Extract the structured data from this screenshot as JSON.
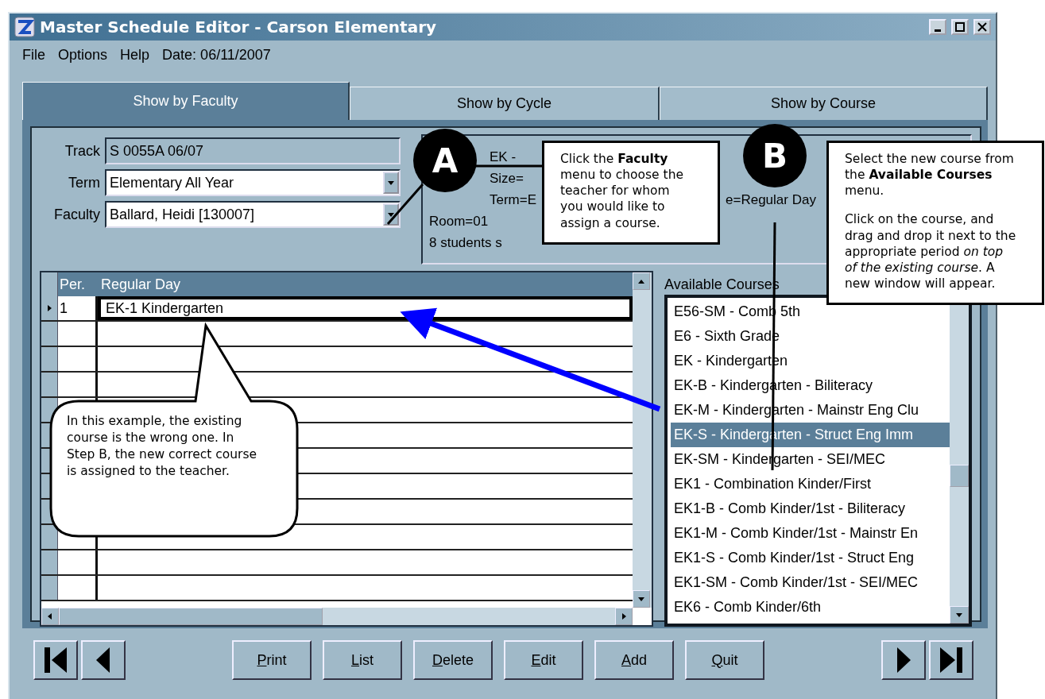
{
  "window": {
    "title": "Master Schedule Editor - Carson Elementary"
  },
  "menu": [
    {
      "label": "File"
    },
    {
      "label": "Options"
    },
    {
      "label": "Help"
    }
  ],
  "date": "Date: 06/11/2007",
  "tabs": [
    {
      "label": "Show by Faculty",
      "selected": true
    },
    {
      "label": "Show by Cycle",
      "selected": false
    },
    {
      "label": "Show by Course",
      "selected": false
    }
  ],
  "form": [
    {
      "label": "Track",
      "value": "S 0055A 06/07",
      "kind": "readonly"
    },
    {
      "label": "Term",
      "value": "Elementary All Year",
      "kind": "dropdown"
    },
    {
      "label": "Faculty",
      "value": "Ballard, Heidi [130007]",
      "kind": "dropdown"
    }
  ],
  "info_lines": [
    {
      "kind": "behind_marker",
      "parts": [
        "EK -"
      ]
    },
    {
      "kind": "behind_marker",
      "parts": [
        "Size="
      ]
    },
    {
      "kind": "behind_marker",
      "parts": [
        "Term=E",
        "e=Regular Day"
      ]
    },
    {
      "kind": "plain",
      "parts": [
        "Room=01"
      ]
    },
    {
      "kind": "plain",
      "parts": [
        "8 students s"
      ]
    }
  ],
  "grid": {
    "columns": [
      "Per.",
      "Regular Day"
    ],
    "rows": [
      {
        "period": "1",
        "course": "EK-1  Kindergarten",
        "current": true
      }
    ]
  },
  "available_courses": {
    "label": "Available Courses",
    "items": [
      {
        "label": "E56-SM - Comb 5th",
        "selected": false
      },
      {
        "label": "E6 - Sixth Grade",
        "selected": false
      },
      {
        "label": "EK - Kindergarten",
        "selected": false
      },
      {
        "label": "EK-B - Kindergarten - Biliteracy",
        "selected": false
      },
      {
        "label": "EK-M - Kindergarten - Mainstr Eng Clu",
        "selected": false
      },
      {
        "label": "EK-S - Kindergarten - Struct Eng Imm",
        "selected": true
      },
      {
        "label": "EK-SM - Kindergarten - SEI/MEC",
        "selected": false
      },
      {
        "label": "EK1 - Combination Kinder/First",
        "selected": false
      },
      {
        "label": "EK1-B - Comb Kinder/1st - Biliteracy",
        "selected": false
      },
      {
        "label": "EK1-M - Comb Kinder/1st - Mainstr En",
        "selected": false
      },
      {
        "label": "EK1-S - Comb Kinder/1st - Struct Eng",
        "selected": false
      },
      {
        "label": "EK1-SM - Comb Kinder/1st - SEI/MEC",
        "selected": false
      },
      {
        "label": "EK6 - Comb Kinder/6th",
        "selected": false
      }
    ]
  },
  "buttons": [
    {
      "label": "Print"
    },
    {
      "label": "List"
    },
    {
      "label": "Delete"
    },
    {
      "label": "Edit"
    },
    {
      "label": "Add"
    },
    {
      "label": "Quit"
    }
  ],
  "annotations": {
    "step_a": {
      "marker": "A",
      "text": "Click the **Faculty** menu to choose the teacher for whom you would like to assign a course."
    },
    "step_b": {
      "marker": "B",
      "paragraphs": [
        "Select the new course from the **Available Courses** menu.",
        "Click on the course, and drag and drop it next to the appropriate period *on top of the existing course*. A new window will appear."
      ]
    },
    "note": "In this example, the existing course is the wrong one. In Step B, the new correct course is assigned to the teacher."
  }
}
